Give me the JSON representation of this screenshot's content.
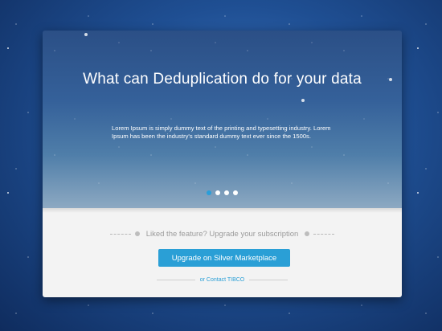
{
  "hero": {
    "title": "What can Deduplication do for your data",
    "body": "Lorem Ipsum is simply dummy text of the printing and typesetting industry. Lorem Ipsum has been the industry's standard dummy text ever since the 1500s.",
    "carousel": {
      "count": 4,
      "active": 1
    }
  },
  "upgrade": {
    "prompt": "Liked the feature? Upgrade your subscription",
    "button_label": "Upgrade on Silver Marketplace",
    "contact_label": "or Contact TIBCO"
  },
  "colors": {
    "accent": "#2a9fd6",
    "panel": "#f3f3f3",
    "background": "#1f4f93"
  }
}
